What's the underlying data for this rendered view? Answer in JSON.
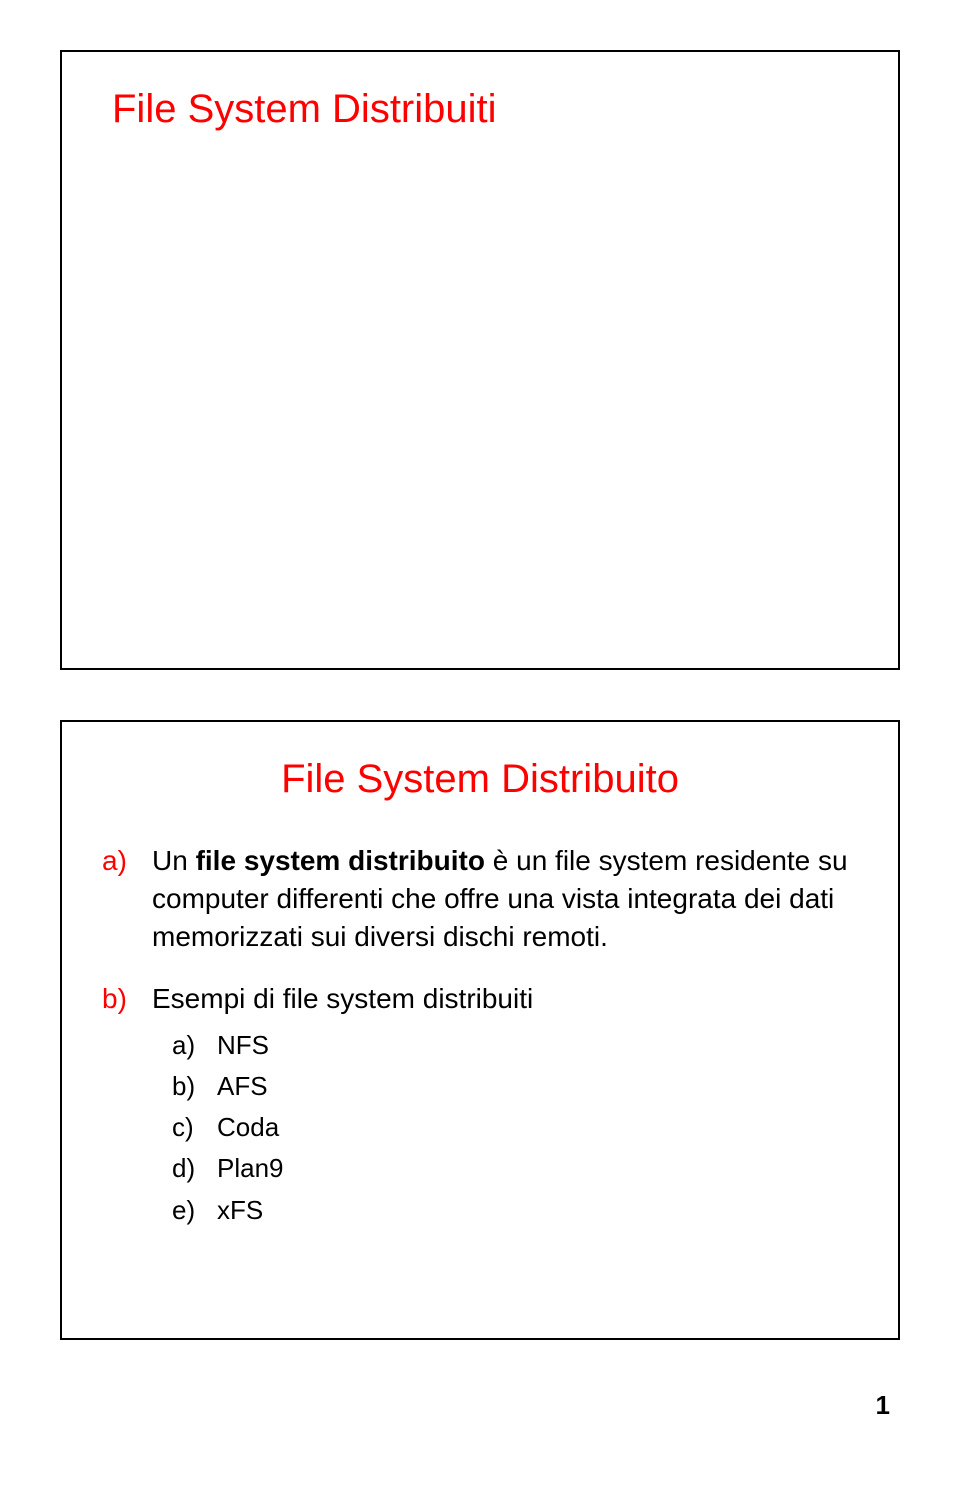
{
  "slide1": {
    "title": "File System Distribuiti"
  },
  "slide2": {
    "title": "File System Distribuito",
    "items": {
      "a": {
        "marker": "a)",
        "bold": "file system distribuito",
        "pre": "Un ",
        "post": " è un file system residente su computer differenti che offre una vista integrata dei dati memorizzati sui diversi dischi remoti."
      },
      "b": {
        "marker": "b)",
        "text": "Esempi di file system distribuiti",
        "sub": [
          {
            "marker": "a)",
            "text": "NFS"
          },
          {
            "marker": "b)",
            "text": "AFS"
          },
          {
            "marker": "c)",
            "text": "Coda"
          },
          {
            "marker": "d)",
            "text": "Plan9"
          },
          {
            "marker": "e)",
            "text": "xFS"
          }
        ]
      }
    }
  },
  "pageNumber": "1"
}
